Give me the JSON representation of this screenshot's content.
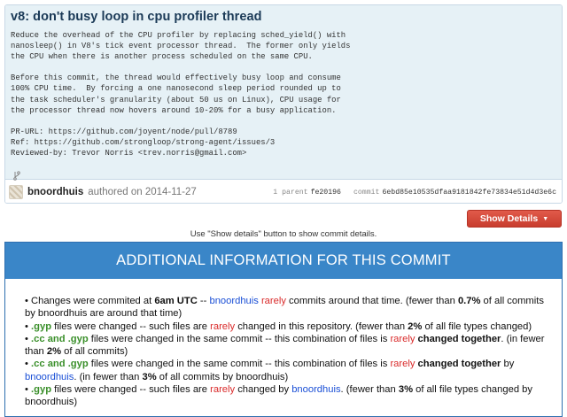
{
  "commit": {
    "title": "v8: don't busy loop in cpu profiler thread",
    "message_lines": [
      "Reduce the overhead of the CPU profiler by replacing sched_yield() with",
      "nanosleep() in V8's tick event processor thread.  The former only yields",
      "the CPU when there is another process scheduled on the same CPU.",
      "",
      "Before this commit, the thread would effectively busy loop and consume",
      "100% CPU time.  By forcing a one nanosecond sleep period rounded up to",
      "the task scheduler's granularity (about 50 us on Linux), CPU usage for",
      "the processor thread now hovers around 10-20% for a busy application.",
      "",
      "PR-URL: https://github.com/joyent/node/pull/8789",
      "Ref: https://github.com/strongloop/strong-agent/issues/3",
      "Reviewed-by: Trevor Norris <trev.norris@gmail.com>"
    ],
    "author": "bnoordhuis",
    "authored_label": "authored on 2014-11-27",
    "parent_count_label": "1 parent",
    "parent_sha": "fe20196",
    "commit_label": "commit",
    "commit_sha": "6ebd85e10535dfaa9181842fe73834e51d4d3e6c",
    "icons": {
      "branch": "branch-icon",
      "avatar": "avatar"
    }
  },
  "show_details": {
    "label": "Show Details",
    "icon": "caret-down-icon",
    "color": "#d64535"
  },
  "hint": "Use \"Show details\" button to show commit details.",
  "info": {
    "header": "ADDITIONAL INFORMATION FOR THIS COMMIT",
    "header_color": "#3a86c8",
    "items": [
      {
        "segments": [
          {
            "t": "• Changes were commited at "
          },
          {
            "t": "6am UTC",
            "c": "b"
          },
          {
            "t": " -- "
          },
          {
            "t": "bnoordhuis",
            "c": "blue"
          },
          {
            "t": " "
          },
          {
            "t": "rarely",
            "c": "red"
          },
          {
            "t": " commits around that time. (fewer than "
          },
          {
            "t": "0.7%",
            "c": "b"
          },
          {
            "t": " of all commits by bnoordhuis are around that time)"
          }
        ]
      },
      {
        "segments": [
          {
            "t": "• "
          },
          {
            "t": ".gyp",
            "c": "green"
          },
          {
            "t": " files were changed -- such files are "
          },
          {
            "t": "rarely",
            "c": "red"
          },
          {
            "t": " changed in this repository. (fewer than "
          },
          {
            "t": "2%",
            "c": "b"
          },
          {
            "t": " of all file types changed)"
          }
        ]
      },
      {
        "segments": [
          {
            "t": "• "
          },
          {
            "t": ".cc and .gyp",
            "c": "green"
          },
          {
            "t": " files were changed in the same commit -- this combination of files is "
          },
          {
            "t": "rarely",
            "c": "red"
          },
          {
            "t": " "
          },
          {
            "t": "changed together",
            "c": "b"
          },
          {
            "t": ". (in fewer than "
          },
          {
            "t": "2%",
            "c": "b"
          },
          {
            "t": " of all commits)"
          }
        ]
      },
      {
        "segments": [
          {
            "t": "• "
          },
          {
            "t": ".cc and .gyp",
            "c": "green"
          },
          {
            "t": " files were changed in the same commit -- this combination of files is "
          },
          {
            "t": "rarely",
            "c": "red"
          },
          {
            "t": " "
          },
          {
            "t": "changed together",
            "c": "b"
          },
          {
            "t": " by "
          },
          {
            "t": "bnoordhuis",
            "c": "blue"
          },
          {
            "t": ". (in fewer than "
          },
          {
            "t": "3%",
            "c": "b"
          },
          {
            "t": " of all commits by bnoordhuis)"
          }
        ]
      },
      {
        "segments": [
          {
            "t": "• "
          },
          {
            "t": ".gyp",
            "c": "green"
          },
          {
            "t": " files were changed -- such files are "
          },
          {
            "t": "rarely",
            "c": "red"
          },
          {
            "t": " changed by "
          },
          {
            "t": "bnoordhuis",
            "c": "blue"
          },
          {
            "t": ". (fewer than "
          },
          {
            "t": "3%",
            "c": "b"
          },
          {
            "t": " of all file types changed by bnoordhuis)"
          }
        ]
      }
    ]
  }
}
